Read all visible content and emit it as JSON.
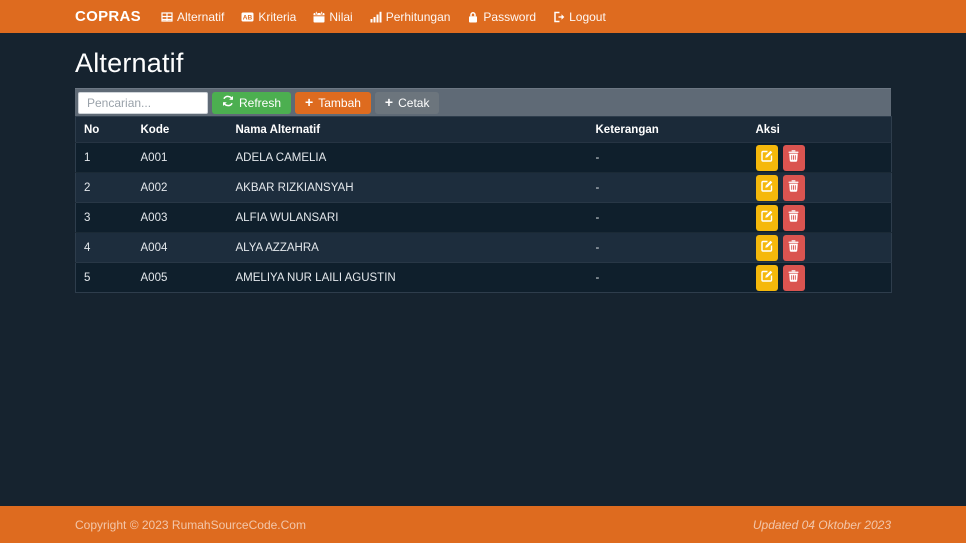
{
  "navbar": {
    "brand": "COPRAS",
    "items": [
      {
        "label": "Alternatif",
        "icon": "table-icon"
      },
      {
        "label": "Kriteria",
        "icon": "ab-card-icon"
      },
      {
        "label": "Nilai",
        "icon": "calendar-icon"
      },
      {
        "label": "Perhitungan",
        "icon": "bar-chart-icon"
      },
      {
        "label": "Password",
        "icon": "lock-icon"
      },
      {
        "label": "Logout",
        "icon": "logout-icon"
      }
    ]
  },
  "page": {
    "title": "Alternatif"
  },
  "toolbar": {
    "search_placeholder": "Pencarian...",
    "refresh_label": "Refresh",
    "tambah_label": "Tambah",
    "cetak_label": "Cetak"
  },
  "table": {
    "headers": [
      "No",
      "Kode",
      "Nama Alternatif",
      "Keterangan",
      "Aksi"
    ],
    "rows": [
      {
        "no": "1",
        "kode": "A001",
        "nama": "ADELA CAMELIA",
        "keterangan": "-"
      },
      {
        "no": "2",
        "kode": "A002",
        "nama": "AKBAR RIZKIANSYAH",
        "keterangan": "-"
      },
      {
        "no": "3",
        "kode": "A003",
        "nama": "ALFIA WULANSARI",
        "keterangan": "-"
      },
      {
        "no": "4",
        "kode": "A004",
        "nama": "ALYA AZZAHRA",
        "keterangan": "-"
      },
      {
        "no": "5",
        "kode": "A005",
        "nama": "AMELIYA NUR LAILI AGUSTIN",
        "keterangan": "-"
      }
    ]
  },
  "footer": {
    "copyright": "Copyright © 2023 RumahSourceCode.Com",
    "updated": "Updated 04 Oktober 2023"
  },
  "colors": {
    "accent_orange": "#DE6B1F",
    "refresh_green": "#4CAF50",
    "gray_button": "#6C757D",
    "edit_yellow": "#F5B80B",
    "delete_red": "#DA5450",
    "page_bg": "#16232F",
    "row_dark": "#0F1F2C",
    "row_light": "#1D2D3D"
  }
}
